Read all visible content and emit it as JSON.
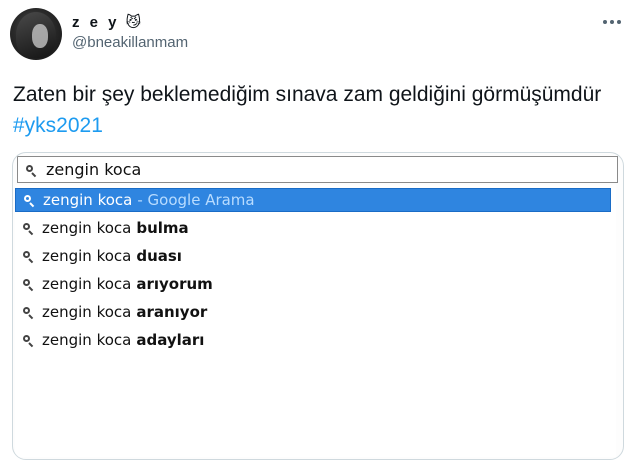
{
  "tweet": {
    "display_name": "z e y",
    "emoji": "😼",
    "handle": "@bneakillanmam",
    "text_main": "Zaten bir şey beklemediğim sınava zam geldiğini görmüşümdür ",
    "hashtag": "#yks2021",
    "hashtag_color": "#1d9bf0"
  },
  "screenshot": {
    "query": "zengin koca",
    "suggestions": [
      {
        "base": "zengin koca",
        "suffix": "- Google Arama",
        "bold": "",
        "selected": true
      },
      {
        "base": "zengin koca",
        "suffix": "",
        "bold": "bulma",
        "selected": false
      },
      {
        "base": "zengin koca",
        "suffix": "",
        "bold": "duası",
        "selected": false
      },
      {
        "base": "zengin koca",
        "suffix": "",
        "bold": "arıyorum",
        "selected": false
      },
      {
        "base": "zengin koca",
        "suffix": "",
        "bold": "aranıyor",
        "selected": false
      },
      {
        "base": "zengin koca",
        "suffix": "",
        "bold": "adayları",
        "selected": false
      }
    ],
    "selected_color": "#2f85e0"
  }
}
